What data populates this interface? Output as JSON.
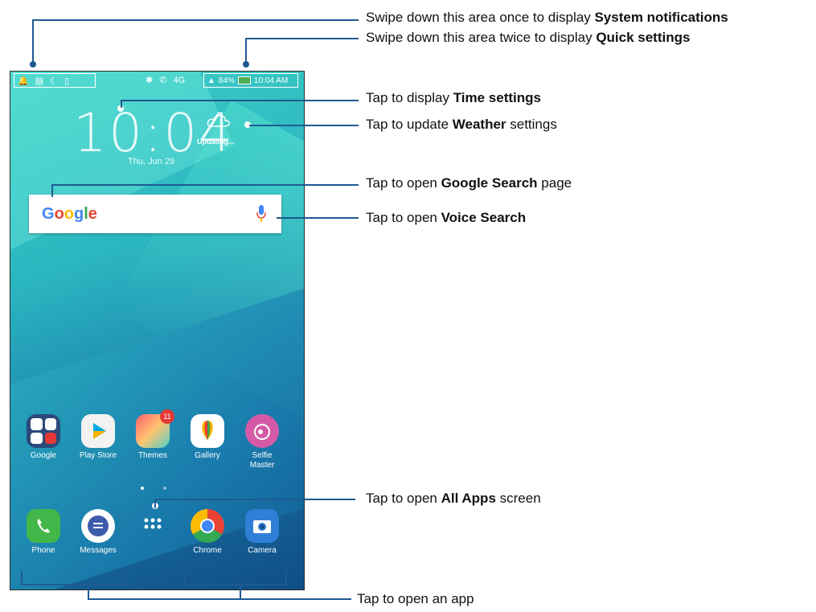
{
  "status_bar": {
    "left_icons": [
      "notification-icon",
      "image-icon",
      "moon-icon",
      "sd-icon"
    ],
    "network": "4G",
    "battery": "84%",
    "time": "10:04 AM"
  },
  "lockscreen": {
    "clock": "10:04",
    "date": "Thu, Jun 29",
    "weather_status": "Updating..."
  },
  "search": {
    "logo": "Google"
  },
  "apps_row1": [
    {
      "label": "Google"
    },
    {
      "label": "Play Store"
    },
    {
      "label": "Themes",
      "badge": "11"
    },
    {
      "label": "Gallery"
    },
    {
      "label": "Selfie\nMaster"
    }
  ],
  "dock": [
    {
      "label": "Phone"
    },
    {
      "label": "Messages"
    },
    {
      "label": ""
    },
    {
      "label": "Chrome"
    },
    {
      "label": "Camera"
    }
  ],
  "annotations": {
    "system_notifications": {
      "prefix": "Swipe down this area once to display ",
      "bold": "System notifications",
      "suffix": ""
    },
    "quick_settings": {
      "prefix": "Swipe down this area twice to display ",
      "bold": "Quick settings",
      "suffix": ""
    },
    "time_settings": {
      "prefix": "Tap to display ",
      "bold": "Time settings",
      "suffix": ""
    },
    "weather": {
      "prefix": "Tap to update ",
      "bold": "Weather",
      "suffix": " settings"
    },
    "google_search": {
      "prefix": "Tap to open ",
      "bold": "Google Search",
      "suffix": " page"
    },
    "voice_search": {
      "prefix": "Tap to open ",
      "bold": "Voice Search",
      "suffix": ""
    },
    "all_apps": {
      "prefix": "Tap to open ",
      "bold": "All Apps",
      "suffix": " screen"
    },
    "open_app": {
      "prefix": "Tap to open an app",
      "bold": "",
      "suffix": ""
    }
  },
  "colors": {
    "annotation_line": "#1f5a91",
    "wallpaper_top": "#3fd0c6",
    "wallpaper_bottom": "#0f4e86"
  }
}
